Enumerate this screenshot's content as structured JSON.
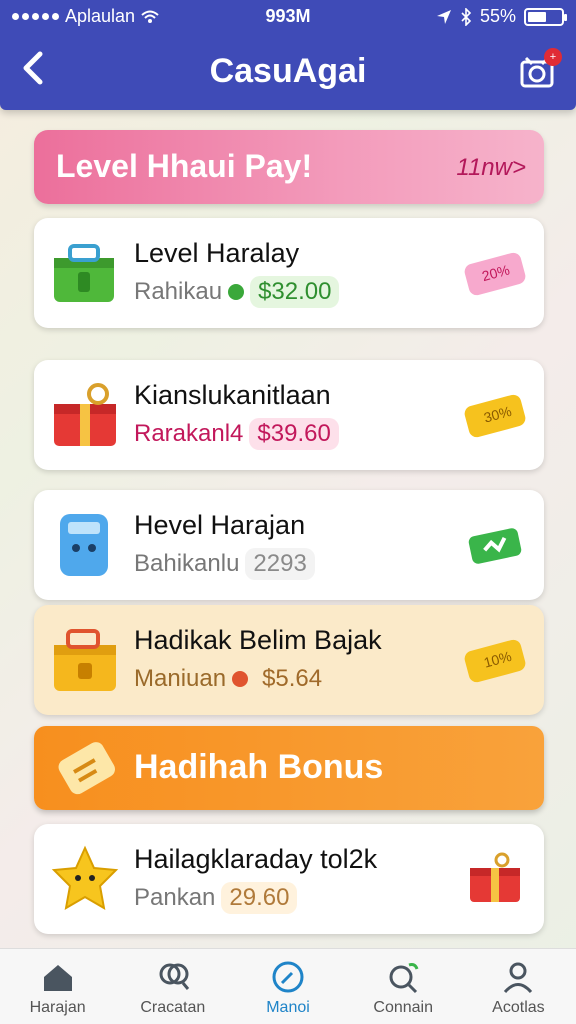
{
  "status_bar": {
    "carrier": "Aplaulan",
    "time": "993M",
    "battery": "55%",
    "battery_level": 0.55
  },
  "header": {
    "title": "CasuAgai",
    "back_icon": "chevron-left-icon",
    "action_icon": "gift-icon",
    "badge": "+"
  },
  "banner": {
    "text": "Level Hhaui Pay!",
    "link": "11nw>"
  },
  "cards": [
    {
      "name": "Level Haralay",
      "sub_label": "Rahikau",
      "price": "$32.00",
      "tag": "20%",
      "dot_color": "#3aa83a",
      "price_bg": "#e5f6df",
      "price_color": "#2f8f2f",
      "tag_color": "#f28fbf",
      "icon": "green-box-icon"
    },
    {
      "name": "Kianslukanitlaan",
      "sub_label": "Rarakanl4",
      "price": "$39.60",
      "tag": "30%",
      "dot_color": "#e33361",
      "price_bg": "#fde0ea",
      "price_color": "#c2185b",
      "tag_color": "#f2bf1e",
      "icon": "red-gift-icon"
    },
    {
      "name": "Hevel Harajan",
      "sub_label": "Bahikanlu",
      "price": "2293",
      "tag": "",
      "dot_color": "#aaaaaa",
      "price_bg": "#f3f3f3",
      "price_color": "#8a8a8a",
      "tag_color": "#3ab54a",
      "icon": "blue-robot-icon"
    },
    {
      "name": "Hadikak Belim Bajak",
      "sub_label": "Maniuan",
      "price": "$5.64",
      "tag": "10%",
      "dot_color": "#e0542e",
      "price_bg": "#fbeac9",
      "price_color": "#a06a2a",
      "tag_color": "#f2c21e",
      "icon": "yellow-box-icon"
    },
    {
      "name": "Hailagklaraday tol2k",
      "sub_label": "Pankan",
      "price": "29.60",
      "tag": "",
      "dot_color": "#999999",
      "price_bg": "#fff2dd",
      "price_color": "#b07a3a",
      "tag_color": "#e53935",
      "icon": "yellow-star-icon"
    }
  ],
  "bonus": {
    "text": "Hadihah Bonus",
    "icon": "ticket-icon"
  },
  "nav": [
    {
      "label": "Harajan",
      "icon": "home-icon",
      "active": false
    },
    {
      "label": "Cracatan",
      "icon": "search-icon",
      "active": false
    },
    {
      "label": "Manoi",
      "icon": "compass-icon",
      "active": true
    },
    {
      "label": "Connain",
      "icon": "magnifier-leaf-icon",
      "active": false
    },
    {
      "label": "Acotlas",
      "icon": "profile-icon",
      "active": false
    }
  ]
}
